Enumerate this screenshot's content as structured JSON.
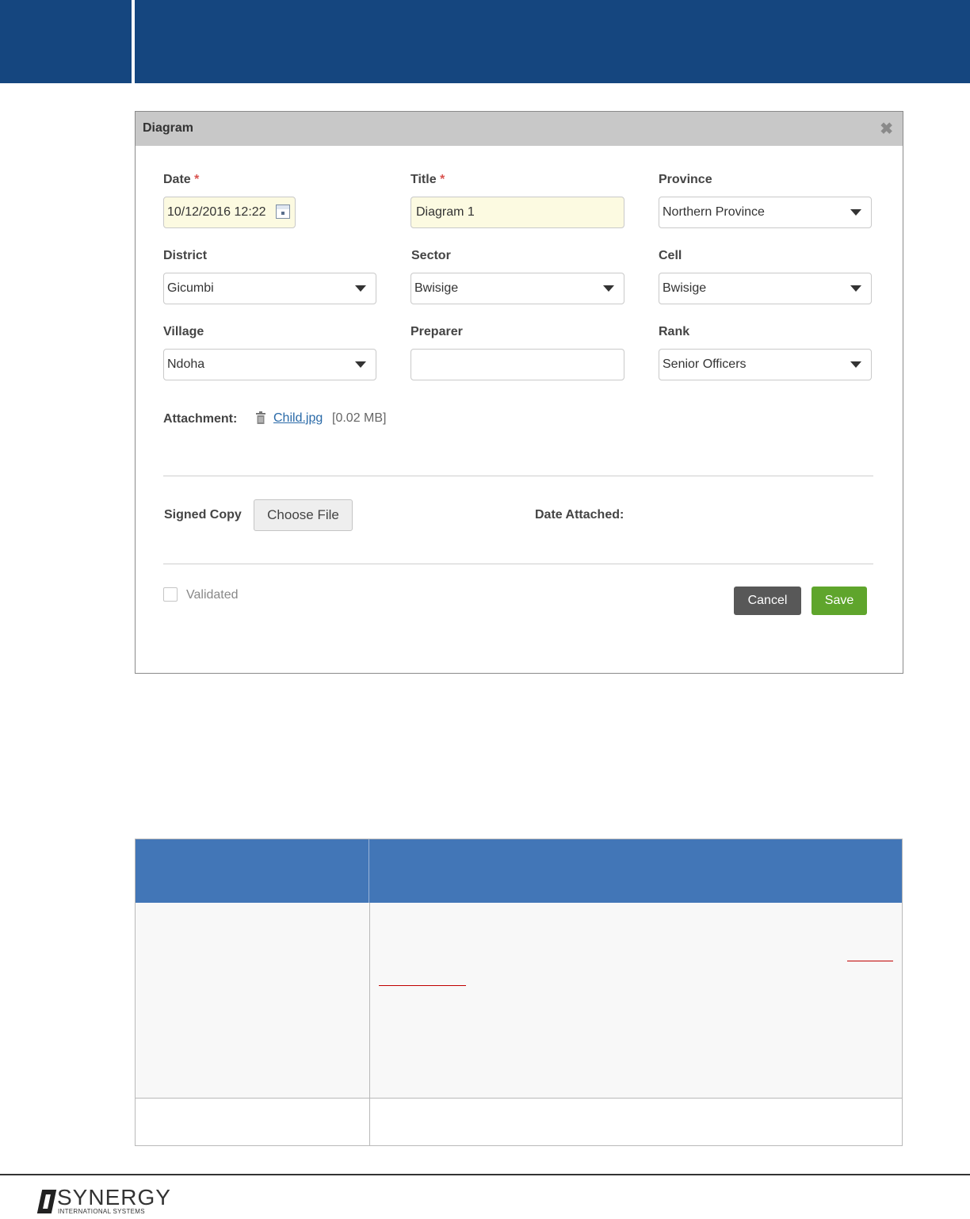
{
  "dialog": {
    "title": "Diagram",
    "close_glyph": "✖"
  },
  "form": {
    "date": {
      "label": "Date",
      "required_mark": "*",
      "value": "10/12/2016 12:22"
    },
    "title": {
      "label": "Title",
      "required_mark": "*",
      "value": "Diagram 1"
    },
    "province": {
      "label": "Province",
      "value": "Northern Province"
    },
    "district": {
      "label": "District",
      "value": "Gicumbi"
    },
    "sector": {
      "label": "Sector",
      "value": "Bwisige"
    },
    "cell": {
      "label": "Cell",
      "value": "Bwisige"
    },
    "village": {
      "label": "Village",
      "value": "Ndoha"
    },
    "preparer": {
      "label": "Preparer",
      "value": ""
    },
    "rank": {
      "label": "Rank",
      "value": "Senior Officers"
    }
  },
  "attachment": {
    "label": "Attachment:",
    "file_name": "Child.jpg",
    "file_size": "[0.02 MB]"
  },
  "signed_copy": {
    "label": "Signed Copy",
    "button_label": "Choose File",
    "date_attached_label": "Date Attached:"
  },
  "validated": {
    "label": "Validated",
    "checked": false
  },
  "actions": {
    "cancel": "Cancel",
    "save": "Save"
  },
  "colors": {
    "header_bar": "#15467f",
    "table_header": "#4276b7",
    "save_button": "#5fa52c",
    "cancel_button": "#585858",
    "required": "#d9534f"
  },
  "footer": {
    "logo_text": "SYNERGY",
    "logo_subtext": "INTERNATIONAL SYSTEMS"
  }
}
